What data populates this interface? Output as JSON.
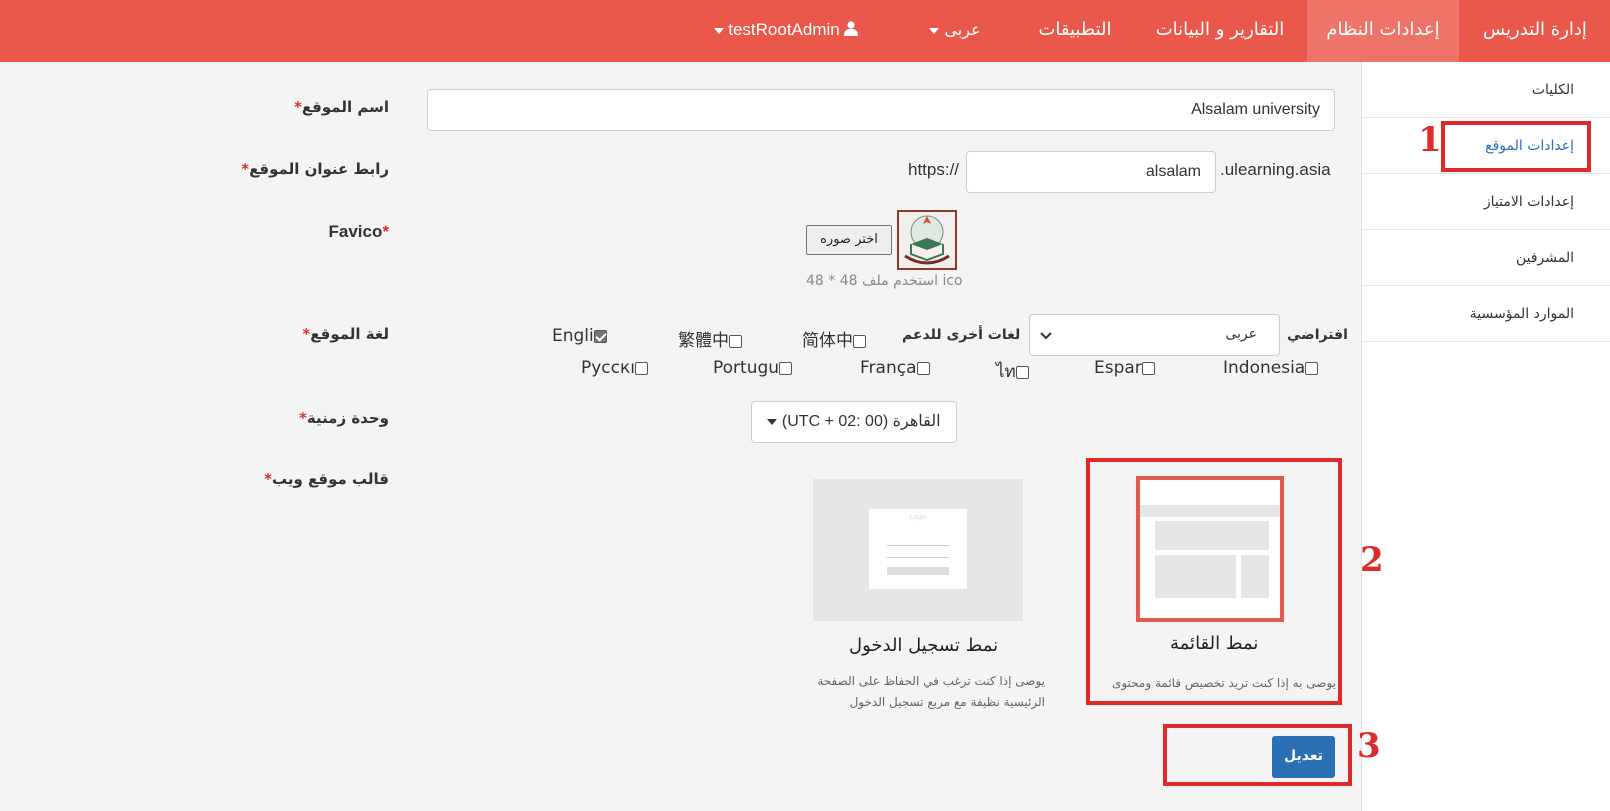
{
  "topbar": {
    "items": [
      {
        "label": "إدارة التدريس"
      },
      {
        "label": "إعدادات النظام"
      },
      {
        "label": "التقارير و البيانات"
      },
      {
        "label": "التطبيقات"
      },
      {
        "label": "عربى"
      },
      {
        "label": "testRootAdmin"
      }
    ],
    "active_color": "#ee7368",
    "bar_color": "#e9584b"
  },
  "sidebar": {
    "items": [
      {
        "label": "الكليات"
      },
      {
        "label": "إعدادات الموقع"
      },
      {
        "label": "إعدادات الامتياز"
      },
      {
        "label": "المشرفين"
      },
      {
        "label": "الموارد المؤسسية"
      }
    ]
  },
  "annotations": [
    "1",
    "2",
    "3"
  ],
  "form": {
    "site_name": {
      "label": "اسم الموقع",
      "value": "Alsalam university"
    },
    "site_url": {
      "label": "رابط عنوان الموقع",
      "prefix": "https://",
      "value": "alsalam",
      "suffix": ".ulearning.asia"
    },
    "favicon": {
      "label": "Favico",
      "button": "اختر صوره",
      "hint": "استخدم ملف 48 * 48 ico"
    },
    "language": {
      "label": "لغة الموقع",
      "default_label": "افتراضي",
      "default_value": "عربى",
      "others_label": "لغات أخرى للدعم",
      "options": [
        {
          "label": "简体中",
          "checked": false
        },
        {
          "label": "繁體中",
          "checked": false
        },
        {
          "label": "Engli",
          "checked": true
        },
        {
          "label": "Indonesia",
          "checked": false
        },
        {
          "label": "Espar",
          "checked": false
        },
        {
          "label": "ไท",
          "checked": false
        },
        {
          "label": "França",
          "checked": false
        },
        {
          "label": "Portugu",
          "checked": false
        },
        {
          "label": "Русскı",
          "checked": false
        }
      ]
    },
    "timezone": {
      "label": "وحدة زمنية",
      "value": "(UTC + 02: 00) القاهرة"
    },
    "template": {
      "label": "قالب موقع ويب",
      "options": [
        {
          "title": "نمط القائمة",
          "desc": "يوصى به إذا كنت تريد تخصيص قائمة ومحتوى الصفحة الرئيسية",
          "selected": true
        },
        {
          "title": "نمط تسجيل الدخول",
          "desc": "يوصى إذا كنت ترغب في الحفاظ على الصفحة الرئيسية نظيفة مع مربع تسجيل الدخول",
          "thumb_text": "Login",
          "selected": false
        }
      ]
    },
    "submit": "تعديل",
    "required_mark": "*"
  }
}
